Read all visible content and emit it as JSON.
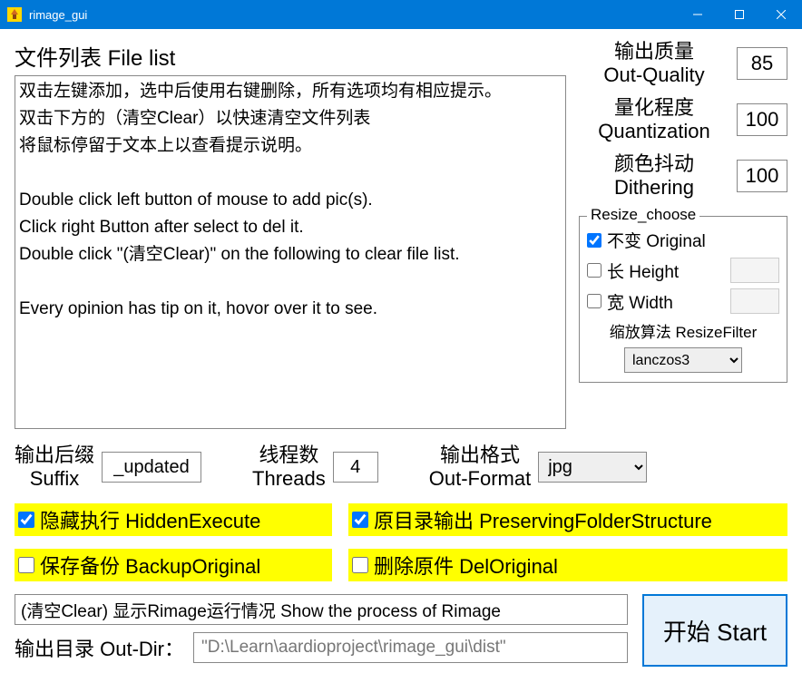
{
  "window": {
    "title": "rimage_gui"
  },
  "file_list": {
    "title": "文件列表 File list",
    "content": "双击左键添加，选中后使用右键删除，所有选项均有相应提示。\n双击下方的（清空Clear）以快速清空文件列表\n将鼠标停留于文本上以查看提示说明。\n\nDouble click left button of mouse to add pic(s).\nClick right Button after select to del it.\nDouble click \"(清空Clear)\" on the following to clear file list.\n\nEvery opinion has tip on it, hovor over it to see."
  },
  "params": {
    "quality": {
      "label_cn": "输出质量",
      "label_en": "Out-Quality",
      "value": "85"
    },
    "quantization": {
      "label_cn": "量化程度",
      "label_en": "Quantization",
      "value": "100"
    },
    "dithering": {
      "label_cn": "颜色抖动",
      "label_en": "Dithering",
      "value": "100"
    }
  },
  "resize": {
    "group_title": "Resize_choose",
    "original": {
      "label": "不变 Original",
      "checked": true
    },
    "height": {
      "label": "长 Height",
      "checked": false,
      "value": ""
    },
    "width": {
      "label": "宽 Width",
      "checked": false,
      "value": ""
    },
    "filter_label": "缩放算法 ResizeFilter",
    "filter_value": "lanczos3"
  },
  "mid": {
    "suffix": {
      "label_cn": "输出后缀",
      "label_en": "Suffix",
      "value": "_updated"
    },
    "threads": {
      "label_cn": "线程数",
      "label_en": "Threads",
      "value": "4"
    },
    "format": {
      "label_cn": "输出格式",
      "label_en": "Out-Format",
      "value": "jpg"
    }
  },
  "checks": {
    "hidden_execute": {
      "label": "隐藏执行 HiddenExecute",
      "checked": true
    },
    "preserving_folder": {
      "label": "原目录输出 PreservingFolderStructure",
      "checked": true
    },
    "backup_original": {
      "label": "保存备份 BackupOriginal",
      "checked": false
    },
    "del_original": {
      "label": "删除原件 DelOriginal",
      "checked": false
    }
  },
  "process": {
    "text": "(清空Clear) 显示Rimage运行情况 Show the process of Rimage"
  },
  "outdir": {
    "label": "输出目录 Out-Dir：",
    "value": "\"D:\\Learn\\aardioproject\\rimage_gui\\dist\""
  },
  "start": {
    "label": "开始 Start"
  }
}
